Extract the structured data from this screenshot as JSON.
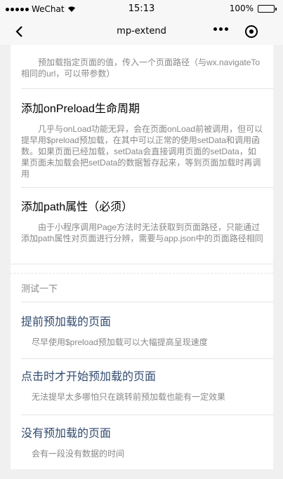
{
  "status_bar": {
    "carrier": "WeChat",
    "time": "15:13",
    "battery": "100%"
  },
  "nav": {
    "title": "mp-extend"
  },
  "partial_text": "预加载指定页面的值，传入一个页面路径（与wx.navigateTo相同的url，可以带参数）",
  "sections": [
    {
      "title": "添加onPreload生命周期",
      "desc": "几乎与onLoad功能无异，会在页面onLoad前被调用，但可以提早用$preload预加载，在其中可以正常的使用setData和调用函数。如果页面已经加载，setData会直接调用页面的setData，如果页面未加载会把setData的数据暂存起来，等到页面加载时再调用"
    },
    {
      "title": "添加path属性（必须）",
      "desc": "由于小程序调用Page方法时无法获取到页面路径，只能通过添加path属性对页面进行分辨，需要与app.json中的页面路径相同"
    }
  ],
  "test": {
    "title": "测试一下",
    "links": [
      {
        "title": "提前预加载的页面",
        "desc": "尽早使用$preload预加载可以大幅提高呈现速度"
      },
      {
        "title": "点击时才开始预加载的页面",
        "desc": "无法提早太多哪怕只在跳转前预加载也能有一定效果"
      },
      {
        "title": "没有预加载的页面",
        "desc": "会有一段没有数据的时间"
      }
    ]
  }
}
